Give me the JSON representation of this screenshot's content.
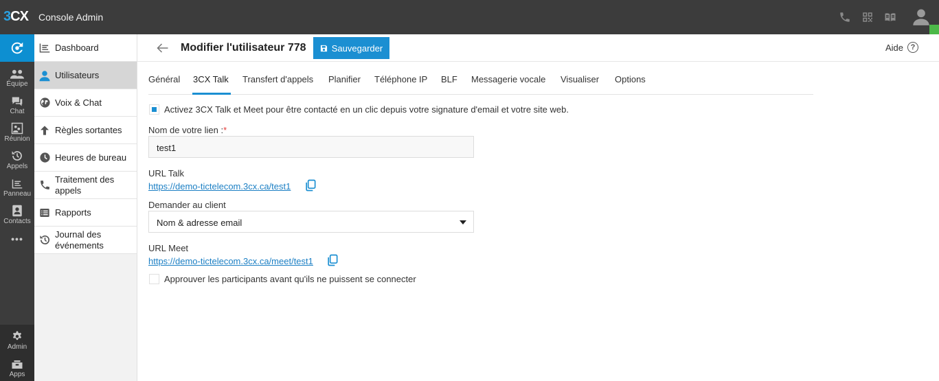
{
  "app": {
    "logo_3": "3",
    "logo_cx": "CX",
    "title": "Console Admin"
  },
  "rail": {
    "items": [
      {
        "label": "Équipe",
        "icon": "team-icon"
      },
      {
        "label": "Chat",
        "icon": "chat-icon"
      },
      {
        "label": "Réunion",
        "icon": "meeting-icon"
      },
      {
        "label": "Appels",
        "icon": "history-icon"
      },
      {
        "label": "Panneau",
        "icon": "panel-icon"
      },
      {
        "label": "Contacts",
        "icon": "contacts-icon"
      }
    ],
    "more": "•••",
    "bottom": [
      {
        "label": "Admin",
        "icon": "gear-icon"
      },
      {
        "label": "Apps",
        "icon": "apps-icon"
      }
    ]
  },
  "subnav": {
    "items": [
      {
        "label": "Dashboard"
      },
      {
        "label": "Utilisateurs"
      },
      {
        "label": "Voix & Chat"
      },
      {
        "label": "Règles sortantes"
      },
      {
        "label": "Heures de bureau"
      },
      {
        "label": "Traitement des appels"
      },
      {
        "label": "Rapports"
      },
      {
        "label": "Journal des événements"
      }
    ]
  },
  "header": {
    "title": "Modifier l'utilisateur 778",
    "save_label": "Sauvegarder",
    "help_label": "Aide"
  },
  "tabs": [
    "Général",
    "3CX Talk",
    "Transfert d'appels",
    "Planifier",
    "Téléphone IP",
    "BLF",
    "Messagerie vocale",
    "Visualiser",
    "Options"
  ],
  "form": {
    "enable_label": "Activez 3CX Talk et Meet pour être contacté en un clic depuis votre signature d'email et votre site web.",
    "enable_checked": true,
    "link_name_label": "Nom de votre lien :",
    "required_mark": "*",
    "link_name_value": "test1",
    "url_talk_label": "URL Talk",
    "url_talk": "https://demo-tictelecom.3cx.ca/test1",
    "ask_client_label": "Demander au client",
    "ask_client_value": "Nom & adresse email",
    "url_meet_label": "URL Meet",
    "url_meet": "https://demo-tictelecom.3cx.ca/meet/test1",
    "approve_label": "Approuver les participants avant qu'ils ne puissent se connecter",
    "approve_checked": false
  },
  "colors": {
    "accent": "#1b8fd2",
    "topbar": "#3c3c3c",
    "status": "#4cb848"
  }
}
